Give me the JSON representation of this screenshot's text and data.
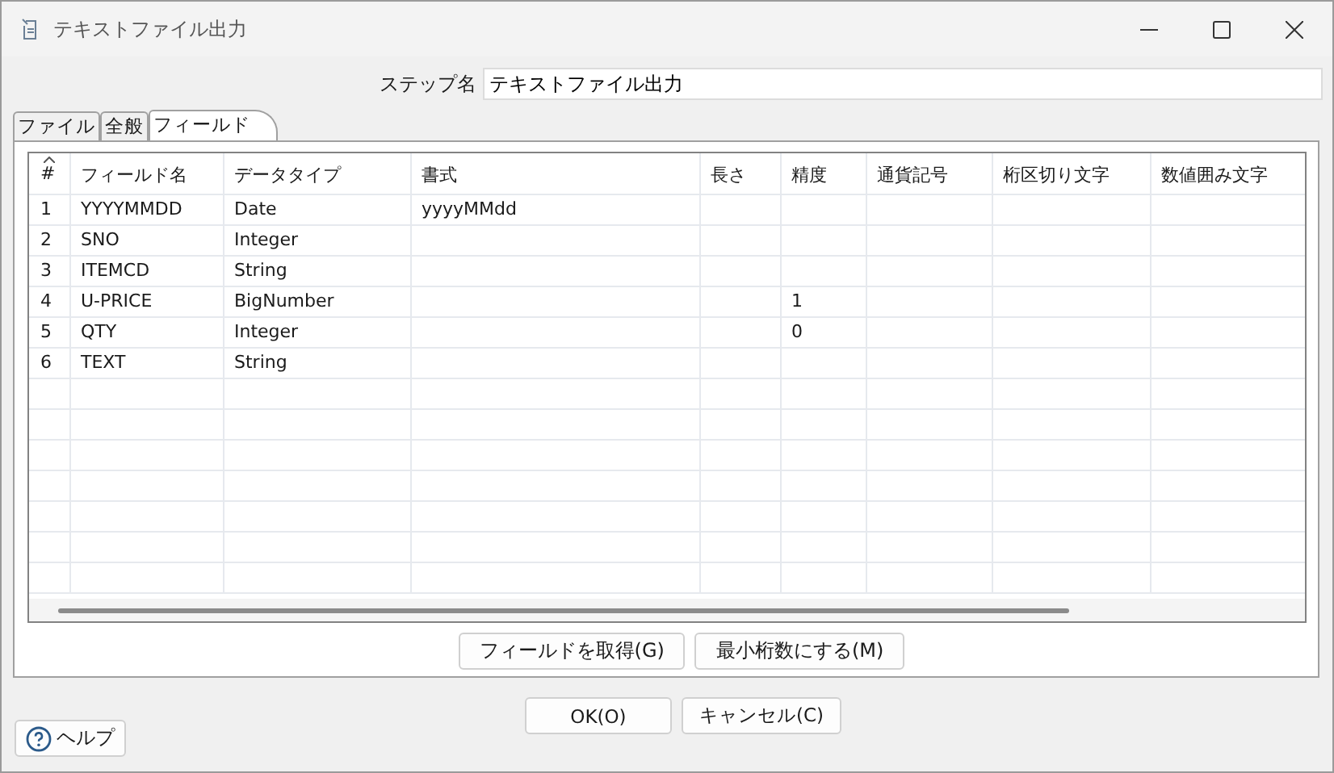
{
  "window": {
    "title": "テキストファイル出力"
  },
  "step_name": {
    "label": "ステップ名",
    "value": "テキストファイル出力"
  },
  "tabs": [
    {
      "label": "ファイル",
      "selected": false
    },
    {
      "label": "全般",
      "selected": false
    },
    {
      "label": "フィールド",
      "selected": true
    }
  ],
  "table": {
    "columns": [
      "#",
      "フィールド名",
      "データタイプ",
      "書式",
      "長さ",
      "精度",
      "通貨記号",
      "桁区切り文字",
      "数値囲み文字"
    ],
    "rows": [
      [
        "1",
        "YYYYMMDD",
        "Date",
        "yyyyMMdd",
        null,
        null,
        null,
        null,
        null
      ],
      [
        "2",
        "SNO",
        "Integer",
        null,
        null,
        null,
        null,
        null,
        null
      ],
      [
        "3",
        "ITEMCD",
        "String",
        null,
        null,
        null,
        null,
        null,
        null
      ],
      [
        "4",
        "U-PRICE",
        "BigNumber",
        null,
        null,
        "1",
        null,
        null,
        null
      ],
      [
        "5",
        "QTY",
        "Integer",
        null,
        null,
        "0",
        null,
        null,
        null
      ],
      [
        "6",
        "TEXT",
        "String",
        null,
        null,
        null,
        null,
        null,
        null
      ]
    ]
  },
  "panel_buttons": [
    "フィールドを取得(G)",
    "最小桁数にする(M)"
  ],
  "dialog_buttons": [
    "OK(O)",
    "キャンセル(C)"
  ],
  "help_button": "ヘルプ"
}
